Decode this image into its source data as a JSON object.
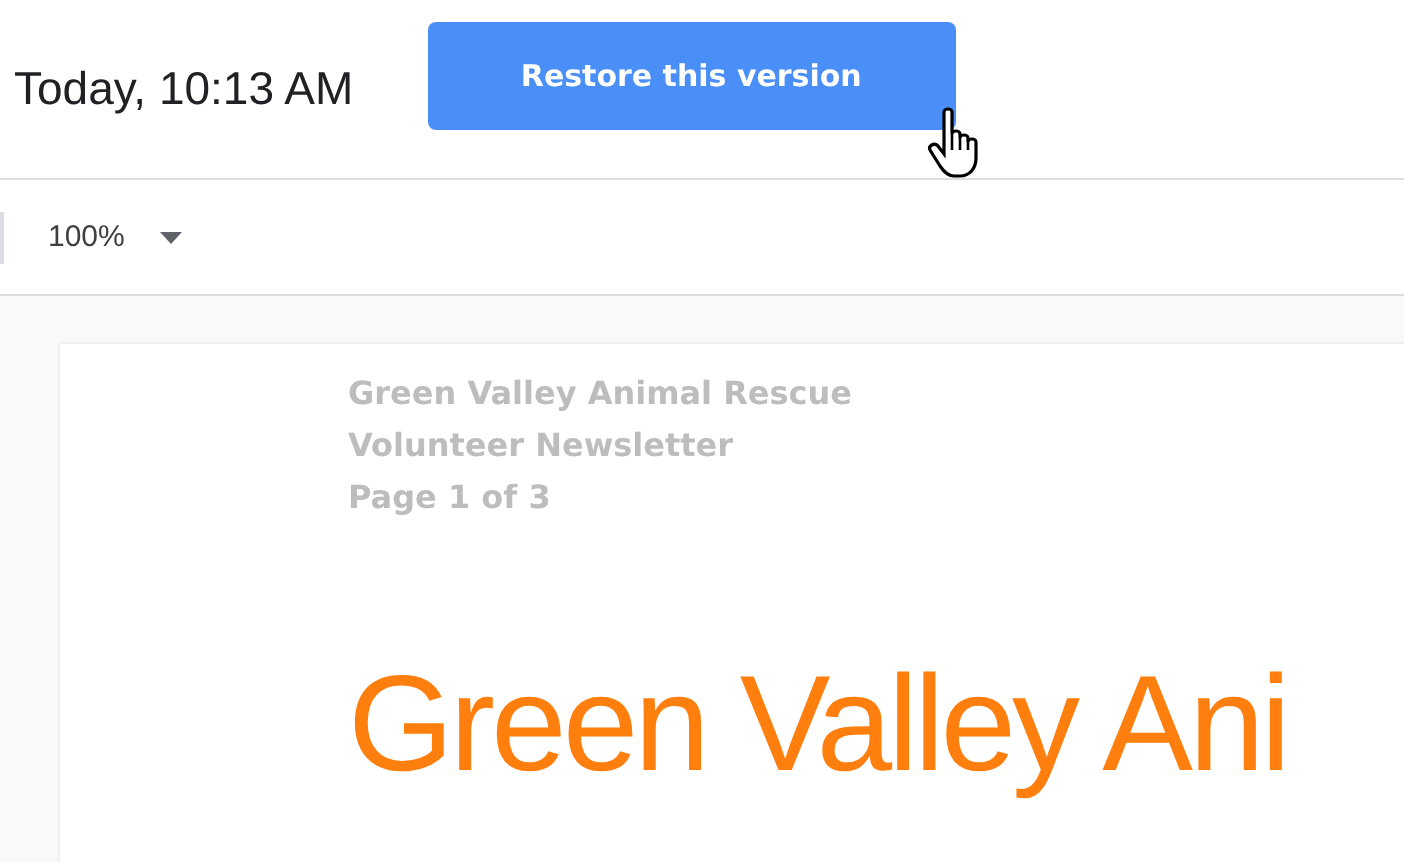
{
  "header": {
    "timestamp": "Today, 10:13 AM",
    "restore_button": "Restore this version"
  },
  "toolbar": {
    "zoom": "100%"
  },
  "document": {
    "header_lines": [
      "Green Valley Animal Rescue",
      "Volunteer Newsletter",
      "Page 1 of 3"
    ],
    "title": "Green Valley Ani"
  }
}
